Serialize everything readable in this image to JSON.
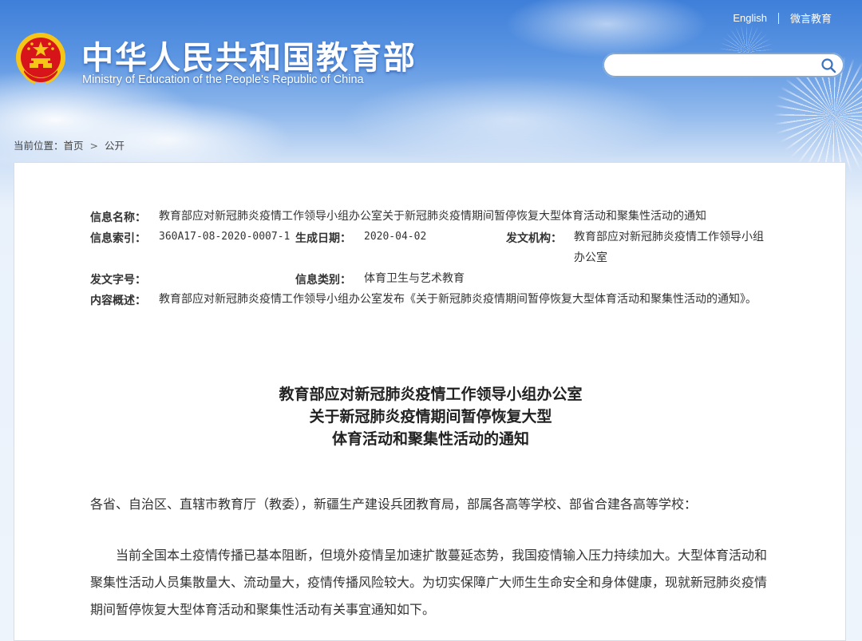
{
  "header": {
    "title": "中华人民共和国教育部",
    "subtitle": "Ministry of Education of the People's Republic of China",
    "links": [
      "English",
      "微言教育"
    ],
    "search_placeholder": ""
  },
  "breadcrumb": {
    "prefix": "当前位置：",
    "items": [
      "首页",
      "公开"
    ],
    "separator": ">"
  },
  "meta": {
    "name_label": "信息名称：",
    "name_value": "教育部应对新冠肺炎疫情工作领导小组办公室关于新冠肺炎疫情期间暂停恢复大型体育活动和聚集性活动的通知",
    "index_label": "信息索引：",
    "index_value": "360A17-08-2020-0007-1",
    "date_label": "生成日期：",
    "date_value": "2020-04-02",
    "org_label": "发文机构：",
    "org_value": "教育部应对新冠肺炎疫情工作领导小组办公室",
    "docno_label": "发文字号：",
    "docno_value": "",
    "category_label": "信息类别：",
    "category_value": "体育卫生与艺术教育",
    "summary_label": "内容概述：",
    "summary_value": "教育部应对新冠肺炎疫情工作领导小组办公室发布《关于新冠肺炎疫情期间暂停恢复大型体育活动和聚集性活动的通知》。"
  },
  "document": {
    "title_lines": [
      "教育部应对新冠肺炎疫情工作领导小组办公室",
      "关于新冠肺炎疫情期间暂停恢复大型",
      "体育活动和聚集性活动的通知"
    ],
    "salutation": "各省、自治区、直辖市教育厅（教委），新疆生产建设兵团教育局，部属各高等学校、部省合建各高等学校：",
    "paragraph1": "当前全国本土疫情传播已基本阻断，但境外疫情呈加速扩散蔓延态势，我国疫情输入压力持续加大。大型体育活动和聚集性活动人员集散量大、流动量大，疫情传播风险较大。为切实保障广大师生生命安全和身体健康，现就新冠肺炎疫情期间暂停恢复大型体育活动和聚集性活动有关事宜通知如下。"
  },
  "colors": {
    "sky_top": "#3f7fd9",
    "emblem_red": "#d7141a",
    "emblem_gold": "#f5c518"
  }
}
